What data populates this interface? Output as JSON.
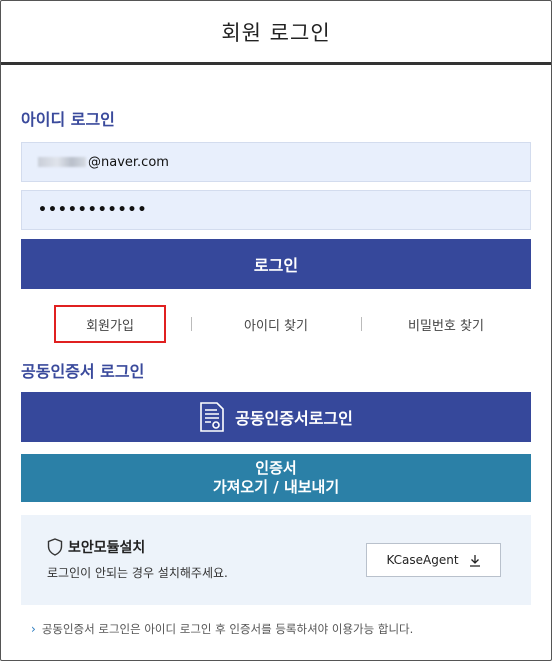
{
  "header": {
    "title": "회원 로그인"
  },
  "id_login": {
    "title": "아이디 로그인",
    "id_value_suffix": "@naver.com",
    "password_mask": "•••••••••••",
    "login_button": "로그인"
  },
  "links": {
    "signup": "회원가입",
    "find_id": "아이디 찾기",
    "find_password": "비밀번호 찾기"
  },
  "cert_login": {
    "title": "공동인증서 로그인",
    "cert_button": "공동인증서로그인",
    "import_line1": "인증서",
    "import_line2": "가져오기 / 내보내기",
    "cert_icon": "certificate-icon"
  },
  "security": {
    "title": "보안모듈설치",
    "description": "로그인이 안되는 경우 설치해주세요.",
    "agent_button": "KCaseAgent",
    "shield_icon": "shield-icon",
    "download_icon": "download-icon"
  },
  "notice": {
    "text": "공동인증서 로그인은 아이디 로그인 후 인증서를 등록하셔야 이용가능 합니다."
  },
  "colors": {
    "primary": "#36489b",
    "secondary": "#2b80a7",
    "input_bg": "#e8effc",
    "highlight_border": "#e02020",
    "section_title": "#3a4a9c"
  }
}
